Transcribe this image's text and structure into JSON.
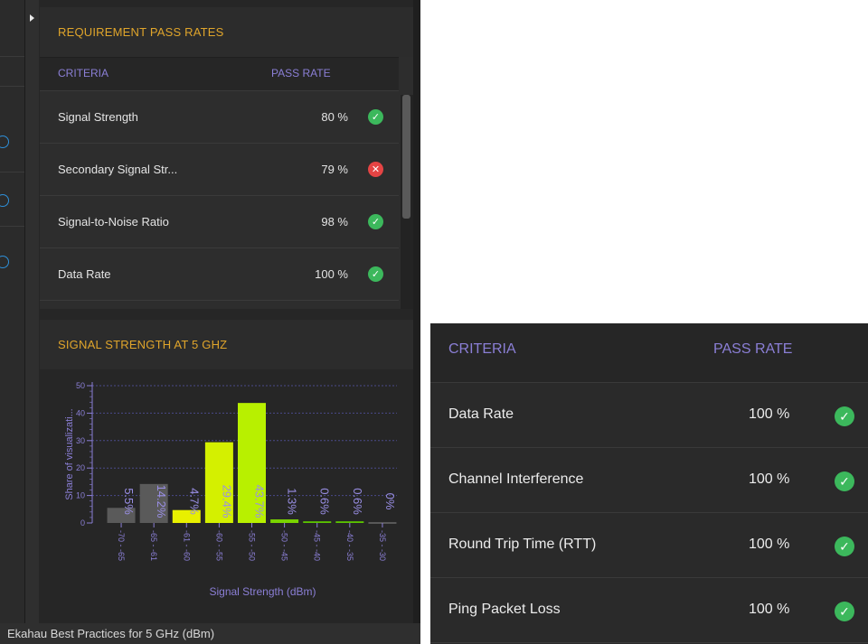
{
  "requirements_panel": {
    "title": "REQUIREMENT PASS RATES",
    "col_criteria": "CRITERIA",
    "col_pass_rate": "PASS RATE",
    "rows": [
      {
        "name": "Signal Strength",
        "rate": "80 %",
        "status": "pass"
      },
      {
        "name": "Secondary Signal Str...",
        "rate": "79 %",
        "status": "fail"
      },
      {
        "name": "Signal-to-Noise Ratio",
        "rate": "98 %",
        "status": "pass"
      },
      {
        "name": "Data Rate",
        "rate": "100 %",
        "status": "pass"
      }
    ],
    "check_glyph": "✓",
    "cross_glyph": "✕"
  },
  "signal_panel": {
    "title": "SIGNAL STRENGTH AT 5 GHZ"
  },
  "chart_data": {
    "type": "bar",
    "title": "SIGNAL STRENGTH AT 5 GHZ",
    "xlabel": "Signal Strength (dBm)",
    "ylabel": "Share of visualizati...",
    "ylim": [
      0,
      50
    ],
    "yticks": [
      "0",
      "10",
      "20",
      "30",
      "40",
      "50"
    ],
    "categories": [
      "-70 - -65",
      "-65 - -61",
      "-61 - -60",
      "-60 - -55",
      "-55 - -50",
      "-50 - -45",
      "-45 - -40",
      "-40 - -35",
      "-35 - -30"
    ],
    "values": [
      5.5,
      14.2,
      4.7,
      29.4,
      43.7,
      1.3,
      0.6,
      0.6,
      0
    ],
    "labels": [
      "5.5%",
      "14.2%",
      "4.7%",
      "29.4%",
      "43.7%",
      "1.3%",
      "0.6%",
      "0.6%",
      "0%"
    ],
    "colors": [
      "#5a5a5a",
      "#5a5a5a",
      "#e8f000",
      "#d4f000",
      "#b8f000",
      "#7ad400",
      "#5cc400",
      "#5cc400",
      "#5cc400"
    ],
    "grid": true
  },
  "status_bar": {
    "text": "Ekahau Best Practices for 5 GHz (dBm)"
  },
  "zoom_panel": {
    "col_criteria": "CRITERIA",
    "col_pass_rate": "PASS RATE",
    "rows": [
      {
        "name": "Data Rate",
        "rate": "100 %",
        "status": "pass"
      },
      {
        "name": "Channel Interference",
        "rate": "100 %",
        "status": "pass"
      },
      {
        "name": "Round Trip Time (RTT)",
        "rate": "100 %",
        "status": "pass"
      },
      {
        "name": "Ping Packet Loss",
        "rate": "100 %",
        "status": "pass"
      }
    ]
  },
  "colors": {
    "accent_orange": "#e0a52b",
    "header_purple": "#8b7fd6",
    "pass_green": "#3cb85c",
    "fail_red": "#e54444",
    "link_blue": "#2e8fd8"
  }
}
